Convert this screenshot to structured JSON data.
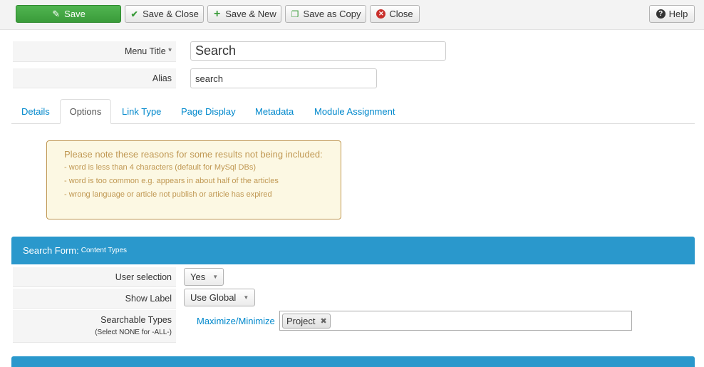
{
  "toolbar": {
    "save": "Save",
    "save_close": "Save & Close",
    "save_new": "Save & New",
    "save_copy": "Save as Copy",
    "close": "Close",
    "help": "Help"
  },
  "form": {
    "menu_title_label": "Menu Title *",
    "menu_title_value": "Search",
    "alias_label": "Alias",
    "alias_value": "search"
  },
  "tabs": [
    "Details",
    "Options",
    "Link Type",
    "Page Display",
    "Metadata",
    "Module Assignment"
  ],
  "active_tab": "Options",
  "notice": {
    "headline": "Please note these reasons for some results not being included:",
    "lines": [
      "- word is less than 4 characters (default for MySql DBs)",
      "- word is too common e.g. appears in about half of the articles",
      "- wrong language or article not publish or article has expired"
    ]
  },
  "section": {
    "title": "Search Form:",
    "subtitle": "Content Types"
  },
  "options": {
    "user_selection_label": "User selection",
    "user_selection_value": "Yes",
    "show_label_label": "Show Label",
    "show_label_value": "Use Global",
    "searchable_types_label": "Searchable Types",
    "searchable_types_hint": "(Select NONE for -ALL-)",
    "maximize_link": "Maximize/Minimize",
    "selected_types": [
      "Project"
    ]
  },
  "colors": {
    "accent": "#2a98cc",
    "save_green": "#46a846",
    "notice_bg": "#fcf8e3",
    "notice_text": "#c09853",
    "link": "#0088cc"
  }
}
